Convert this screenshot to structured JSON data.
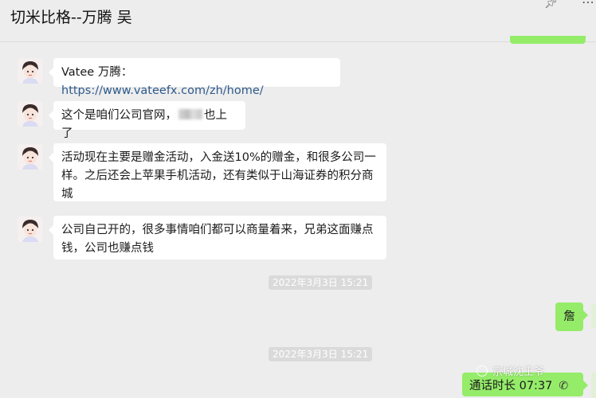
{
  "header": {
    "title": "切米比格--万腾  吴",
    "pin_icon": "pin-icon",
    "more_icon": "more-icon"
  },
  "messages": [
    {
      "prefix": "Vatee 万腾：",
      "link": "https://www.vateefx.com/zh/home/"
    },
    {
      "text_before": "这个是咱们公司官网，",
      "text_after": "也上了"
    },
    {
      "text": "活动现在主要是赠金活动，入金送10%的赠金，和很多公司一样。之后还会上苹果手机活动，还有类似于山海证券的积分商城"
    },
    {
      "text": "公司自己开的，很多事情咱们都可以商量着来，兄弟这面赚点钱，公司也赚点钱"
    }
  ],
  "timestamps": [
    "2022年3月3日 15:21",
    "2022年3月3日 15:21"
  ],
  "outgoing": {
    "message": "詹",
    "call_label": "通话时长 07:37",
    "call_icon": "phone-icon"
  },
  "watermark": "京城沈王爷",
  "colors": {
    "background": "#ededed",
    "incoming_bubble": "#ffffff",
    "outgoing_bubble": "#95ec69",
    "link": "#2d5a8c",
    "timestamp_bg": "#dadada"
  }
}
